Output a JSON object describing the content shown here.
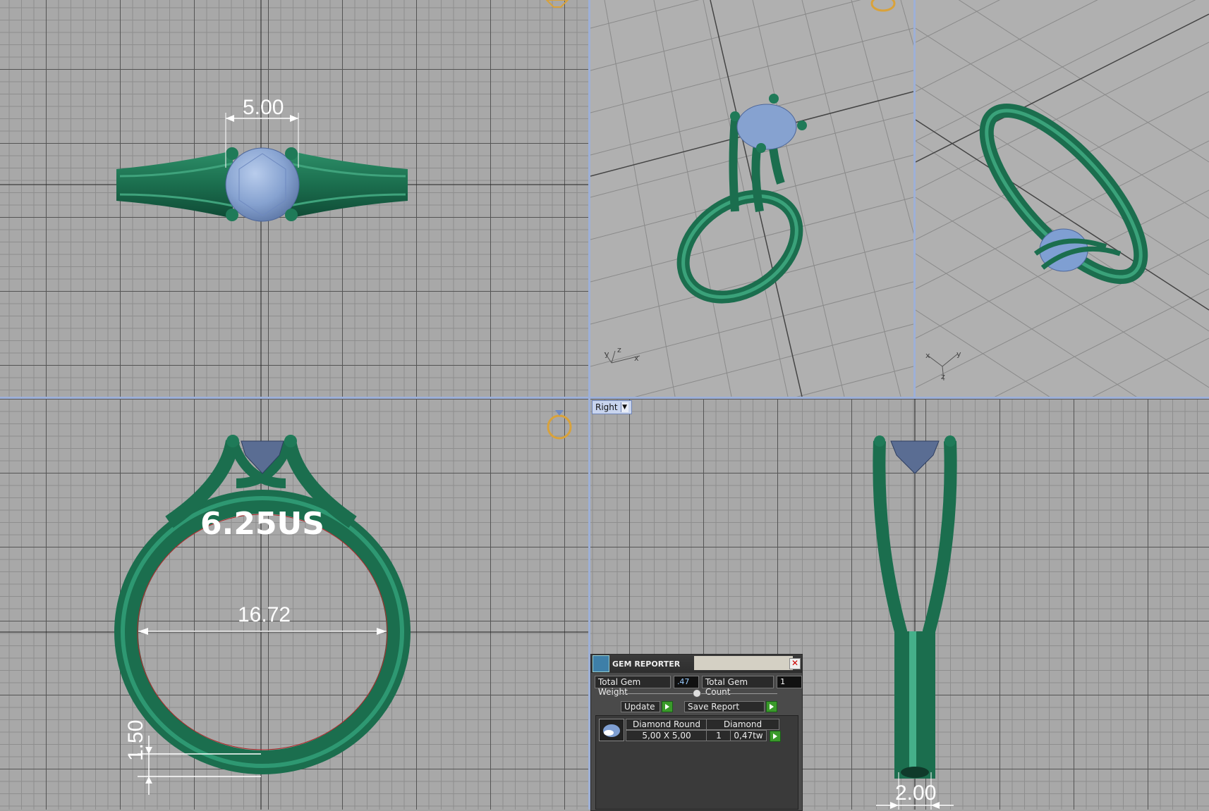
{
  "viewports": {
    "top": {
      "dimension_label": "5.00"
    },
    "front": {
      "ring_size": "6.25US",
      "inner_diameter": "16.72",
      "band_height": "1.50"
    },
    "right": {
      "view_name": "Right",
      "band_width": "2.00"
    },
    "perspective_left": {
      "axis_labels": [
        "y",
        "z",
        "x"
      ]
    },
    "perspective_right": {
      "axis_labels": [
        "x",
        "y",
        "z"
      ]
    }
  },
  "gem_reporter": {
    "title": "GEM REPORTER",
    "total_gem_weight_label": "Total Gem Weight",
    "total_gem_weight_value": ".47",
    "total_gem_count_label": "Total Gem Count",
    "total_gem_count_value": "1",
    "update_label": "Update",
    "save_report_label": "Save Report",
    "gems": [
      {
        "shape": "Diamond Round",
        "material": "Diamond",
        "size": "5,00 X 5,00",
        "count": "1",
        "weight": "0,47tw"
      }
    ]
  },
  "colors": {
    "ring_green": "#1f7a58",
    "gem_blue": "#7f9fd2",
    "grid_bg": "#a8a8a8",
    "separator": "#9db0d8"
  },
  "icons": [
    "gem-icon",
    "close-icon",
    "play-icon",
    "dropdown-arrow-icon",
    "ring-orientation-icon"
  ]
}
